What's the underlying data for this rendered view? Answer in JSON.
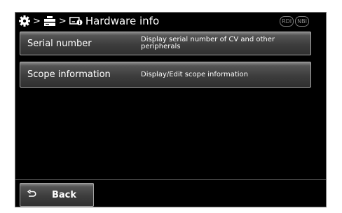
{
  "header": {
    "breadcrumb_separator": ">",
    "title": "Hardware info",
    "icons": [
      "gear-icon",
      "equipment-icon",
      "hardware-info-icon"
    ],
    "badges": [
      "RDI",
      "NBI"
    ]
  },
  "menu": [
    {
      "label": "Serial number",
      "description": "Display serial number of CV and other peripherals"
    },
    {
      "label": "Scope information",
      "description": "Display/Edit scope information"
    }
  ],
  "footer": {
    "back_label": "Back",
    "back_icon": "return-arrow-icon"
  },
  "colors": {
    "screen_bg": "#000000",
    "button_face": "#3d3d3d",
    "button_border": "#a8a8a8",
    "text": "#ffffff"
  }
}
